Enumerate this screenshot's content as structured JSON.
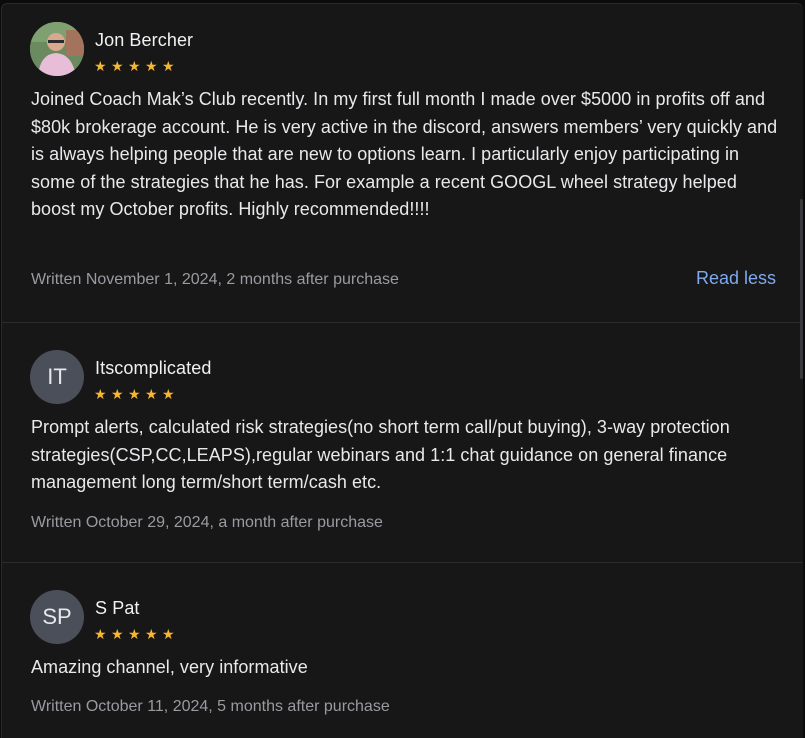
{
  "reviews": [
    {
      "author": "Jon Bercher",
      "avatar_initials": "",
      "rating": 5,
      "text": "Joined Coach Mak’s Club recently. In my first full month I made over $5000 in profits off and $80k brokerage account. He is very active in the discord, answers members’ very quickly and is always helping people that are new to options learn. I particularly enjoy participating in some of the strategies that he has. For example a recent GOOGL wheel strategy helped boost my October profits. Highly recommended!!!!",
      "written": "Written November 1, 2024, 2 months after purchase",
      "toggle_label": "Read less"
    },
    {
      "author": "Itscomplicated",
      "avatar_initials": "IT",
      "rating": 5,
      "text": "Prompt alerts, calculated risk strategies(no short term call/put buying), 3-way protection strategies(CSP,CC,LEAPS),regular webinars and 1:1 chat guidance on general finance management long term/short term/cash etc.",
      "written": "Written October 29, 2024, a month after purchase"
    },
    {
      "author": "S Pat",
      "avatar_initials": "SP",
      "rating": 5,
      "text": "Amazing channel, very informative",
      "written": "Written October 11, 2024, 5 months after purchase"
    }
  ],
  "colors": {
    "star": "#f5b731",
    "link": "#7fa8ef",
    "background": "#171718"
  },
  "icons": {
    "star": "star-icon",
    "avatar_photo": "avatar-photo"
  }
}
